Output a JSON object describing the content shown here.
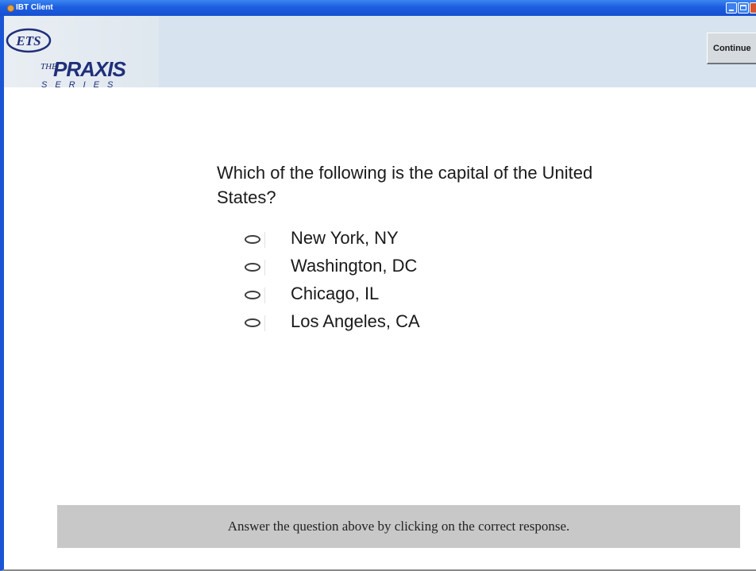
{
  "window": {
    "title": "IBT Client"
  },
  "header": {
    "logo_ets": "ETS",
    "logo_the": "THE",
    "logo_praxis": "PRAXIS",
    "logo_series": "SERIES",
    "continue_label": "Continue"
  },
  "question": {
    "text": "Which of the following is the capital of the United States?",
    "options": [
      {
        "label": "New York, NY",
        "selected": false
      },
      {
        "label": "Washington, DC",
        "selected": false
      },
      {
        "label": "Chicago, IL",
        "selected": false
      },
      {
        "label": "Los Angeles, CA",
        "selected": false
      }
    ]
  },
  "instruction": {
    "text": "Answer the question above by clicking on the correct response."
  },
  "colors": {
    "titlebar": "#1d5ee0",
    "header_bg": "#d7e3ee",
    "logo_blue": "#1f2f7a",
    "instruction_bg": "#c8c8c8"
  }
}
